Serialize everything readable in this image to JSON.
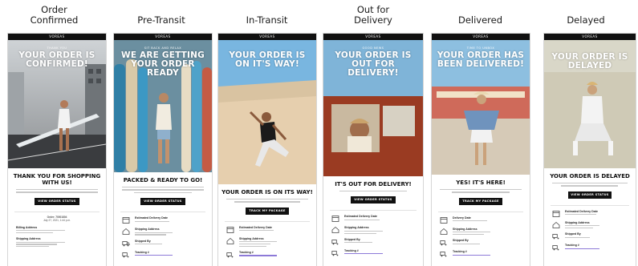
{
  "brand": "VOREAS",
  "colors": {
    "accent_purple": "#8d7ad8",
    "button": "#111111",
    "header": "#111111"
  },
  "columns": [
    {
      "heading": "Order\nConfirmed",
      "kicker": "THANK YOU",
      "hero_title": "YOUR ORDER IS CONFIRMED!",
      "headline": "THANK YOU FOR SHOPPING WITH US!",
      "cta": "VIEW ORDER STATUS",
      "order_line_1": "Order: 70001804",
      "order_line_2": "July 27, 2021, 1:44 p.m.",
      "details": [
        {
          "icon": "mail-icon",
          "label": "Billing Address"
        },
        {
          "icon": "home-icon",
          "label": "Shipping Address"
        }
      ]
    },
    {
      "heading": "Pre-Transit",
      "kicker": "SIT BACK AND RELAX",
      "hero_title": "WE ARE GETTING YOUR ORDER READY",
      "headline": "PACKED & READY TO GO!",
      "cta": "VIEW ORDER STATUS",
      "details": [
        {
          "icon": "calendar-icon",
          "label": "Estimated Delivery Date"
        },
        {
          "icon": "home-icon",
          "label": "Shipping Address"
        },
        {
          "icon": "truck-icon",
          "label": "Shipped By"
        },
        {
          "icon": "truck-icon",
          "label": "Tracking #"
        }
      ]
    },
    {
      "heading": "In-Transit",
      "kicker": "",
      "hero_title": "YOUR ORDER IS ON IT'S WAY!",
      "headline": "YOUR ORDER IS ON ITS WAY!",
      "cta": "TRACK MY PACKAGE",
      "details": [
        {
          "icon": "calendar-icon",
          "label": "Estimated Delivery Date"
        },
        {
          "icon": "home-icon",
          "label": "Shipping Address"
        },
        {
          "icon": "truck-icon",
          "label": "Tracking #"
        }
      ]
    },
    {
      "heading": "Out for\nDelivery",
      "kicker": "GOOD NEWS",
      "hero_title": "YOUR ORDER IS OUT FOR DELIVERY!",
      "headline": "IT'S OUT FOR DELIVERY!",
      "cta": "VIEW ORDER STATUS",
      "details": [
        {
          "icon": "calendar-icon",
          "label": "Estimated Delivery Date"
        },
        {
          "icon": "home-icon",
          "label": "Shipping Address"
        },
        {
          "icon": "truck-icon",
          "label": "Shipped By"
        },
        {
          "icon": "truck-icon",
          "label": "Tracking #"
        }
      ]
    },
    {
      "heading": "Delivered",
      "kicker": "TIME TO UNBOX",
      "hero_title": "YOUR ORDER HAS BEEN DELIVERED!",
      "headline": "YES! IT'S HERE!",
      "cta": "TRACK MY PACKAGE",
      "details": [
        {
          "icon": "calendar-icon",
          "label": "Delivery Date"
        },
        {
          "icon": "home-icon",
          "label": "Shipping Address"
        },
        {
          "icon": "truck-icon",
          "label": "Shipped By"
        },
        {
          "icon": "truck-icon",
          "label": "Tracking #"
        }
      ]
    },
    {
      "heading": "Delayed",
      "kicker": "",
      "hero_title": "YOUR ORDER IS DELAYED",
      "headline": "YOUR ORDER IS DELAYED",
      "cta": "VIEW ORDER STATUS",
      "details": [
        {
          "icon": "calendar-icon",
          "label": "Estimated Delivery Date"
        },
        {
          "icon": "home-icon",
          "label": "Shipping Address"
        },
        {
          "icon": "truck-icon",
          "label": "Shipped By"
        },
        {
          "icon": "truck-icon",
          "label": "Tracking #"
        }
      ]
    }
  ]
}
